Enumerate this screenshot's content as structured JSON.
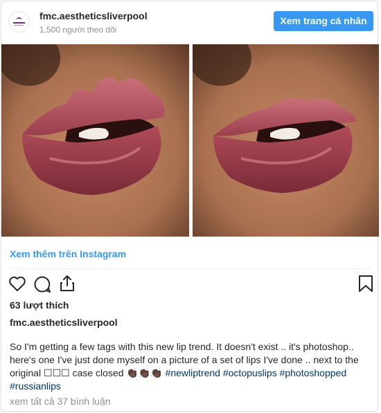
{
  "header": {
    "username": "fmc.aestheticsliverpool",
    "followers": "1,500 người theo dõi",
    "profile_button": "Xem trang cá nhân"
  },
  "links": {
    "view_more": "Xem thêm trên Instagram"
  },
  "icons": [
    "heart-icon",
    "comment-icon",
    "share-icon",
    "bookmark-icon"
  ],
  "post": {
    "likes": "63 lượt thích",
    "caption_user": "fmc.aestheticsliverpool",
    "caption_text": "So I'm getting a few tags with this new lip trend. It doesn't exist .. it's photoshop.. here's one I've just done myself on a picture of a set of lips I've done .. next to the original ☐☐☐ case closed 👏🏿👏🏿👏🏿",
    "hashtags": [
      "#newliptrend",
      "#octopuslips",
      "#photoshopped",
      "#russianlips"
    ],
    "comments_link": "xem tất cả 37 bình luận"
  },
  "colors": {
    "accent": "#3897f0",
    "hashtag": "#003569",
    "muted": "#8e8e8e"
  }
}
